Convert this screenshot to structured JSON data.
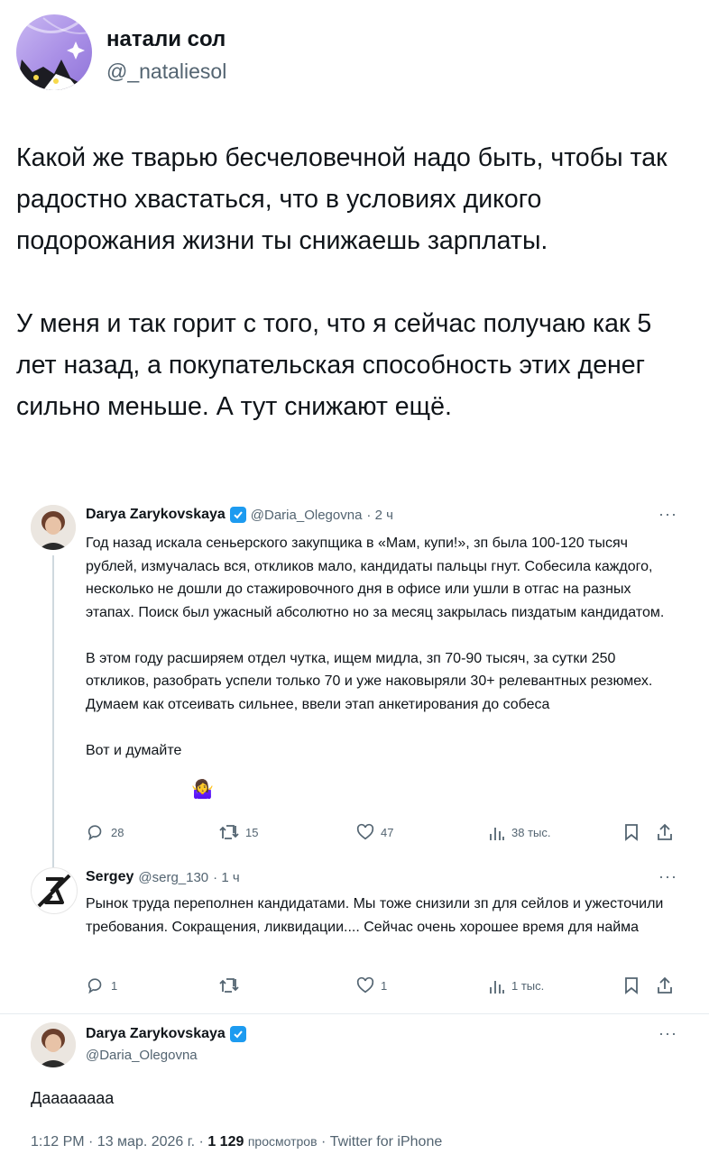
{
  "outer": {
    "name": "натали сол",
    "handle": "@_nataliesol",
    "body": "Какой же тварью бесчеловечной надо быть, чтобы так радостно хвастаться, что в условиях дикого подорожания жизни ты снижаешь зарплаты.\n\nУ меня и так горит с того, что я сейчас получаю как 5 лет назад, а покупательская способность этих денег сильно меньше. А тут снижают ещё."
  },
  "tweet1": {
    "name": "Darya Zarykovskaya",
    "handle": "@Daria_Olegovna",
    "time": "· 2 ч",
    "more": "···",
    "text": "Год назад искала сеньерского закупщика в «Мам, купи!», зп была 100-120 тысяч рублей, измучалась вся, откликов мало, кандидаты пальцы гнут. Собесила каждого, несколько не дошли до стажировочного дня в офисе или ушли в отгас на разных этапах. Поиск был ужасный абсолютно но за месяц закрылась пиздатым кандидатом.\n\nВ этом году расширяем отдел чутка, ищем мидла, зп 70-90 тысяч, за сутки 250 откликов, разобрать успели только 70 и уже наковыряли 30+ релевантных резюмех. Думаем как отсеивать сильнее, ввели этап анкетирования до собеса\n\nВот и думайте",
    "emoji": "🤷‍♀️",
    "replies": "28",
    "retweets": "15",
    "likes": "47",
    "views": "38 тыс."
  },
  "tweet2": {
    "name": "Sergey",
    "handle": "@serg_130",
    "time": "· 1 ч",
    "more": "···",
    "text": "Рынок труда переполнен кандидатами. Мы тоже снизили зп для сейлов и ужесточили требования. Сокращения, ликвидации.... Сейчас очень хорошее время для найма",
    "replies": "1",
    "retweets": "",
    "likes": "1",
    "views": "1 тыс."
  },
  "tweet3": {
    "name": "Darya Zarykovskaya",
    "handle": "@Daria_Olegovna",
    "more": "···",
    "text": "Даааааааа",
    "footer_time": "1:12 PM · 13 мар. 2026 г. ·",
    "footer_views_count": "1 129",
    "footer_views_label": "просмотров",
    "footer_source": "· Twitter for iPhone"
  },
  "colors": {
    "accent": "#1d9bf0",
    "text": "#0f1419",
    "muted": "#536471"
  }
}
